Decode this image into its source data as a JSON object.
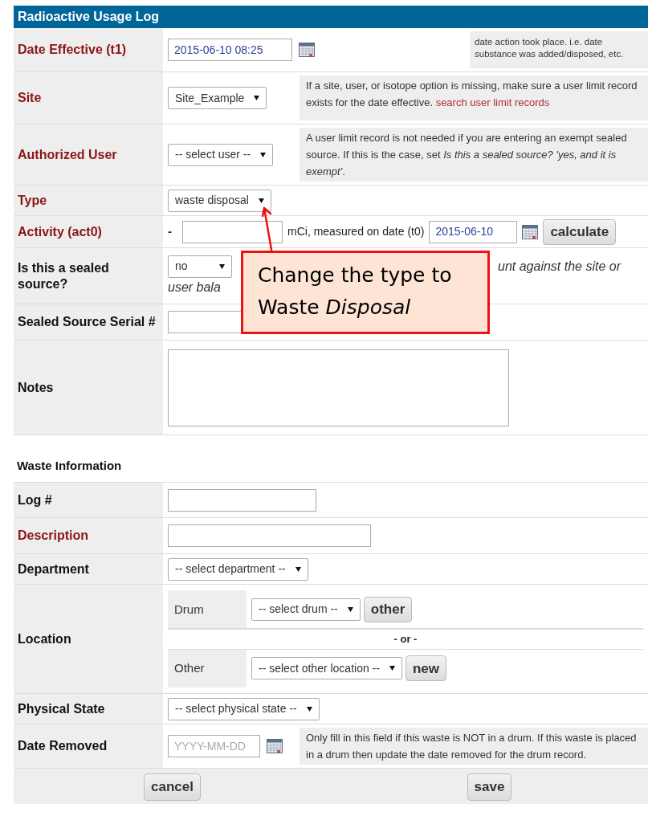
{
  "title": "Radioactive Usage Log",
  "main_rows": [
    {
      "kind": "date",
      "label": "Date Effective (t1)",
      "required": true,
      "value": "2015-06-10 08:25",
      "note": "date action took place. i.e. date substance was added/disposed, etc."
    },
    {
      "kind": "select",
      "label": "Site",
      "required": true,
      "value": "Site_Example",
      "note": "If a site, user, or isotope option is missing, make sure a user limit record exists for the date effective.",
      "link": "search user limit records"
    },
    {
      "kind": "select",
      "label": "Authorized User",
      "required": true,
      "value": "-- select user --",
      "note": "A user limit record is not needed if you are entering an exempt sealed source. If this is the case, set *Is this a sealed source? 'yes, and it is exempt'*."
    },
    {
      "kind": "select",
      "label": "Type",
      "required": true,
      "value": "waste disposal"
    },
    {
      "kind": "activity",
      "label": "Activity (act0)",
      "required": true,
      "prefix": "-",
      "unit": "mCi, measured on date (t0)",
      "date": "2015-06-10",
      "button": "calculate"
    },
    {
      "kind": "sealed",
      "label": "Is this a sealed source?",
      "required": false,
      "value": "no",
      "note_end": "unt against the site or",
      "note_wrap": "user bala"
    },
    {
      "kind": "wide_text",
      "label": "Sealed Source Serial #",
      "required": false
    },
    {
      "kind": "textarea",
      "label": "Notes",
      "required": false
    }
  ],
  "waste": {
    "heading": "Waste Information",
    "rows": [
      {
        "kind": "text",
        "label": "Log #",
        "required": false
      },
      {
        "kind": "wide_text",
        "label": "Description",
        "required": true
      },
      {
        "kind": "select",
        "label": "Department",
        "required": false,
        "value": "-- select department --"
      },
      {
        "kind": "location",
        "label": "Location",
        "required": false,
        "separator": "- or -",
        "options": [
          {
            "label": "Drum",
            "value": "-- select drum --",
            "button": "other"
          },
          {
            "label": "Other",
            "value": "-- select other location --",
            "button": "new"
          }
        ]
      },
      {
        "kind": "select",
        "label": "Physical State",
        "required": false,
        "value": "-- select physical state --"
      },
      {
        "kind": "date",
        "label": "Date Removed",
        "required": false,
        "placeholder": "YYYY-MM-DD",
        "note": "Only fill in this field if this waste is NOT in a drum. If this waste is placed in a drum then update the date removed for the drum record."
      }
    ]
  },
  "buttons": [
    "cancel",
    "save"
  ],
  "callout": {
    "text": "Change the type to Waste *Disposal*"
  }
}
